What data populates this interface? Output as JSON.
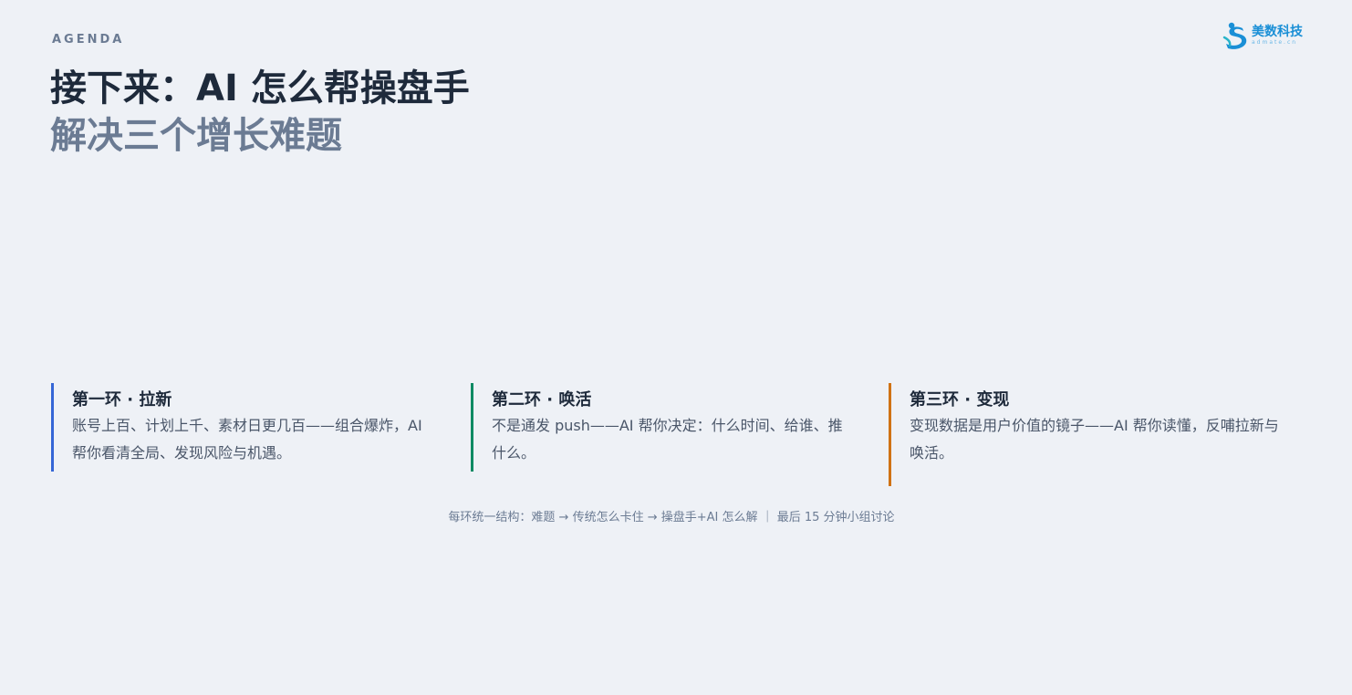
{
  "header": {
    "eyebrow": "AGENDA",
    "title": "接下来：AI 怎么帮操盘手",
    "subtitle": "解决三个增长难题"
  },
  "logo": {
    "name": "美数科技",
    "domain": "admate.cn",
    "icon": "admate-logo-icon"
  },
  "cards": [
    {
      "title": "第一环 · 拉新",
      "body": "账号上百、计划上千、素材日更几百——组合爆炸，AI 帮你看清全局、发现风险与机遇。",
      "accent": "#3566d6"
    },
    {
      "title": "第二环 · 唤活",
      "body": "不是通发 push——AI 帮你决定：什么时间、给谁、推什么。",
      "accent": "#0e8a63"
    },
    {
      "title": "第三环 · 变现",
      "body": "变现数据是用户价值的镜子——AI 帮你读懂，反哺拉新与唤活。",
      "accent": "#d07214"
    }
  ],
  "footer": {
    "note": "每环统一结构：难题 → 传统怎么卡住 → 操盘手+AI 怎么解 ｜ 最后 15 分钟小组讨论"
  },
  "colors": {
    "background": "#eef1f6",
    "title": "#1e2a3b",
    "muted": "#6b7b93"
  }
}
